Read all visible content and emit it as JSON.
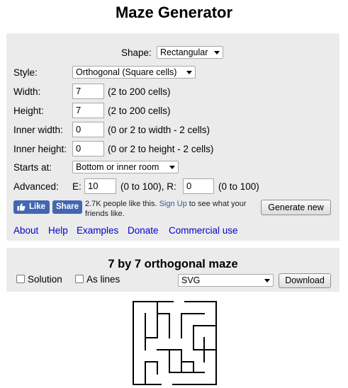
{
  "page": {
    "title": "Maze Generator"
  },
  "form": {
    "shape_label": "Shape:",
    "shape_value": "Rectangular",
    "style_label": "Style:",
    "style_value": "Orthogonal (Square cells)",
    "width_label": "Width:",
    "width_value": "7",
    "width_hint": "(2 to 200 cells)",
    "height_label": "Height:",
    "height_value": "7",
    "height_hint": "(2 to 200 cells)",
    "inner_width_label": "Inner width:",
    "inner_width_value": "0",
    "inner_width_hint": "(0 or 2 to width - 2 cells)",
    "inner_height_label": "Inner height:",
    "inner_height_value": "0",
    "inner_height_hint": "(0 or 2 to height - 2 cells)",
    "starts_at_label": "Starts at:",
    "starts_at_value": "Bottom or inner room",
    "advanced_label": "Advanced:",
    "e_label": "E:",
    "e_value": "10",
    "e_hint": "(0 to 100), R:",
    "r_value": "0",
    "r_hint": "(0 to 100)"
  },
  "social": {
    "like_label": "Like",
    "share_label": "Share",
    "text_before": "2.7K people like this.",
    "signup_link": "Sign Up",
    "text_after": "to see what your",
    "text_line2": "friends like.",
    "brand_color": "#4267b2"
  },
  "generate_button": "Generate new",
  "links": [
    "About",
    "Help",
    "Examples",
    "Donate",
    "Commercial use"
  ],
  "result": {
    "maze_title": "7 by 7 orthogonal maze",
    "solution_label": "Solution",
    "as_lines_label": "As lines",
    "format_value": "SVG",
    "download_label": "Download"
  }
}
